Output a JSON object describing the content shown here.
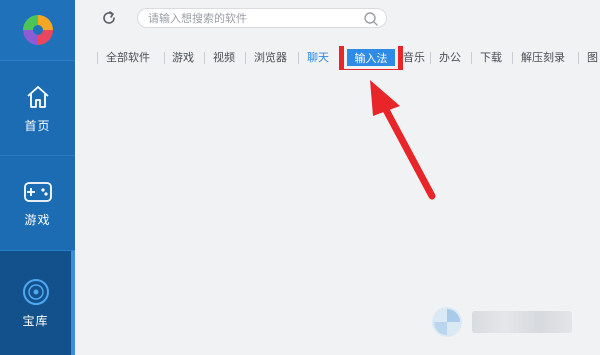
{
  "sidebar": {
    "items": [
      {
        "label": "首页",
        "icon": "home-icon"
      },
      {
        "label": "游戏",
        "icon": "gamepad-icon"
      },
      {
        "label": "宝库",
        "icon": "disc-icon"
      }
    ]
  },
  "search": {
    "placeholder": "请输入想搜索的软件"
  },
  "tabs": [
    "全部软件",
    "游戏",
    "视频",
    "浏览器",
    "聊天",
    "输入法",
    "音乐",
    "办公",
    "下载",
    "解压刻录",
    "图"
  ],
  "selected_tab": "输入法",
  "colors": {
    "sidebar": "#1d6bb0",
    "sidebar_active": "#13518c",
    "accent": "#2e8be6",
    "highlight": "#e8262a",
    "background": "#f1f2f4"
  }
}
